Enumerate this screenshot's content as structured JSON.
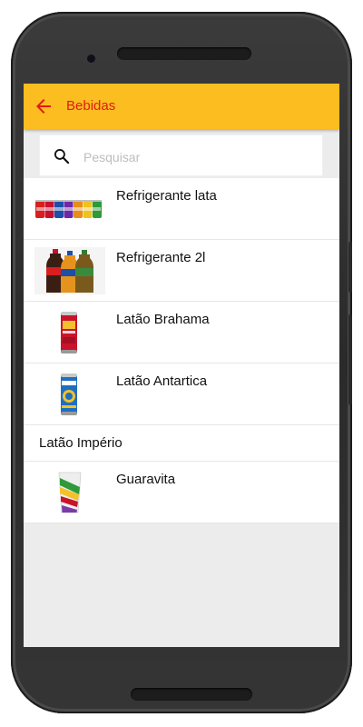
{
  "appbar": {
    "title": "Bebidas",
    "back_icon": "arrow-left-icon"
  },
  "search": {
    "placeholder": "Pesquisar",
    "value": ""
  },
  "items": [
    {
      "label": "Refrigerante lata",
      "image": "soda-cans-image"
    },
    {
      "label": "Refrigerante 2l",
      "image": "soda-bottles-image"
    },
    {
      "label": "Latão Brahama",
      "image": "brahma-can-image"
    },
    {
      "label": "Latão Antartica",
      "image": "antartica-can-image"
    },
    {
      "label": "Latão Império"
    },
    {
      "label": "Guaravita",
      "image": "guaravita-cup-image"
    }
  ],
  "colors": {
    "appbar": "#fbbd20",
    "accent": "#e41b13",
    "background": "#ececec"
  }
}
